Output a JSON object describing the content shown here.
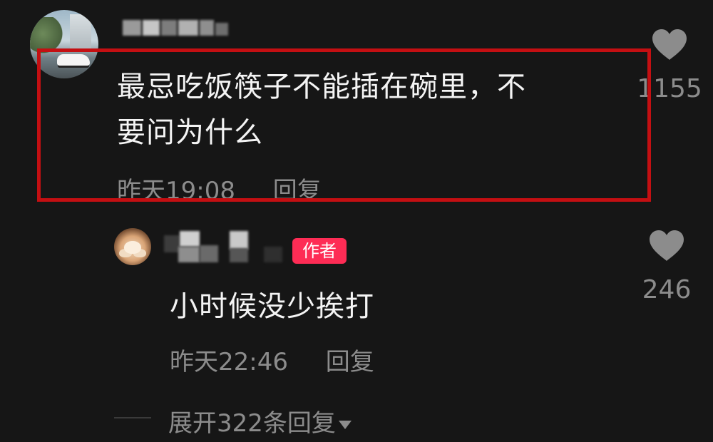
{
  "comments": [
    {
      "text_line1": "最忌吃饭筷子不能插在碗里，不",
      "text_line2": "要问为什么",
      "time": "昨天19:08",
      "reply_label": "回复",
      "likes": "1155",
      "highlighted": true
    }
  ],
  "reply": {
    "badge": "作者",
    "text": "小时候没少挨打",
    "time": "昨天22:46",
    "reply_label": "回复",
    "likes": "246"
  },
  "expand": {
    "label": "展开322条回复"
  },
  "colors": {
    "background": "#161616",
    "text": "#f4f4f4",
    "muted": "#8c8c8c",
    "badge": "#fe2c55",
    "highlight_frame": "#c40f12",
    "heart": "#8c8c8c"
  },
  "icons": {
    "like": "heart-icon",
    "expand": "caret-down-icon"
  }
}
